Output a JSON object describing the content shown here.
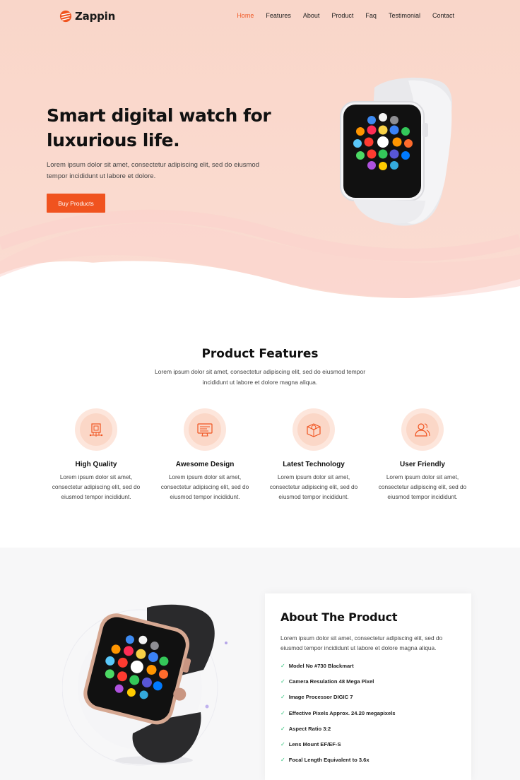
{
  "header": {
    "logo_text": "Zappin",
    "nav": [
      {
        "label": "Home",
        "active": true
      },
      {
        "label": "Features",
        "active": false
      },
      {
        "label": "About",
        "active": false
      },
      {
        "label": "Product",
        "active": false
      },
      {
        "label": "Faq",
        "active": false
      },
      {
        "label": "Testimonial",
        "active": false
      },
      {
        "label": "Contact",
        "active": false
      }
    ]
  },
  "hero": {
    "title": "Smart digital watch for luxurious life.",
    "description": "Lorem ipsum dolor sit amet, consectetur adipiscing elit, sed do eiusmod tempor incididunt ut labore et dolore.",
    "button_label": "Buy Products"
  },
  "features": {
    "title": "Product Features",
    "description": "Lorem ipsum dolor sit amet, consectetur adipiscing elit, sed do eiusmod tempor incididunt ut labore et dolore magna aliqua.",
    "items": [
      {
        "title": "High Quality",
        "text": "Lorem ipsum dolor sit amet, consectetur adipiscing elit, sed do eiusmod tempor incididunt.",
        "icon": "chip-icon"
      },
      {
        "title": "Awesome Design",
        "text": "Lorem ipsum dolor sit amet, consectetur adipiscing elit, sed do eiusmod tempor incididunt.",
        "icon": "monitor-icon"
      },
      {
        "title": "Latest Technology",
        "text": "Lorem ipsum dolor sit amet, consectetur adipiscing elit, sed do eiusmod tempor incididunt.",
        "icon": "box-icon"
      },
      {
        "title": "User Friendly",
        "text": "Lorem ipsum dolor sit amet, consectetur adipiscing elit, sed do eiusmod tempor incididunt.",
        "icon": "users-icon"
      }
    ]
  },
  "about": {
    "title": "About The Product",
    "description": "Lorem ipsum dolor sit amet, consectetur adipiscing elit, sed do eiusmod tempor incididunt ut labore et dolore magna aliqua.",
    "specs": [
      "Model No #730 Blackmart",
      "Camera Resulation 48 Mega Pixel",
      "Image Processor DIGIC 7",
      "Effective Pixels Approx. 24.20 megapixels",
      "Aspect Ratio 3:2",
      "Lens Mount EF/EF-S",
      "Focal Length Equivalent to 3.6x"
    ]
  },
  "colors": {
    "accent": "#f0531f",
    "hero_bg": "#fbd9cd",
    "check": "#2fc37a"
  }
}
